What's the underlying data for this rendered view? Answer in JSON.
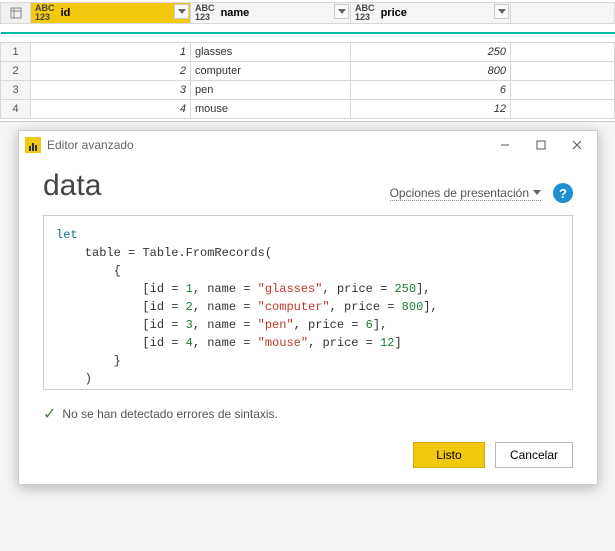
{
  "table": {
    "columns": [
      {
        "name": "id",
        "selected": true
      },
      {
        "name": "name",
        "selected": false
      },
      {
        "name": "price",
        "selected": false
      }
    ],
    "rows": [
      {
        "n": "1",
        "id": "1",
        "name": "glasses",
        "price": "250"
      },
      {
        "n": "2",
        "id": "2",
        "name": "computer",
        "price": "800"
      },
      {
        "n": "3",
        "id": "3",
        "name": "pen",
        "price": "6"
      },
      {
        "n": "4",
        "id": "4",
        "name": "mouse",
        "price": "12"
      }
    ]
  },
  "dialog": {
    "title": "Editor avanzado",
    "heading": "data",
    "options_label": "Opciones de presentación",
    "status": "No se han detectado errores de sintaxis.",
    "buttons": {
      "done": "Listo",
      "cancel": "Cancelar"
    },
    "code_html": "<span class=\"kw\">let</span>\n    table = Table.FromRecords(\n        {\n            [id = <span class=\"num\">1</span>, name = <span class=\"str\">\"glasses\"</span>, price = <span class=\"num\">250</span>],\n            [id = <span class=\"num\">2</span>, name = <span class=\"str\">\"computer\"</span>, price = <span class=\"num\">800</span>],\n            [id = <span class=\"num\">3</span>, name = <span class=\"str\">\"pen\"</span>, price = <span class=\"num\">6</span>],\n            [id = <span class=\"num\">4</span>, name = <span class=\"str\">\"mouse\"</span>, price = <span class=\"num\">12</span>]\n        }\n    )\n<span class=\"kw\">in</span>\n    <span class=\"kw\">table</span>"
  },
  "chart_data": {
    "type": "table",
    "columns": [
      "id",
      "name",
      "price"
    ],
    "rows": [
      [
        1,
        "glasses",
        250
      ],
      [
        2,
        "computer",
        800
      ],
      [
        3,
        "pen",
        6
      ],
      [
        4,
        "mouse",
        12
      ]
    ]
  }
}
